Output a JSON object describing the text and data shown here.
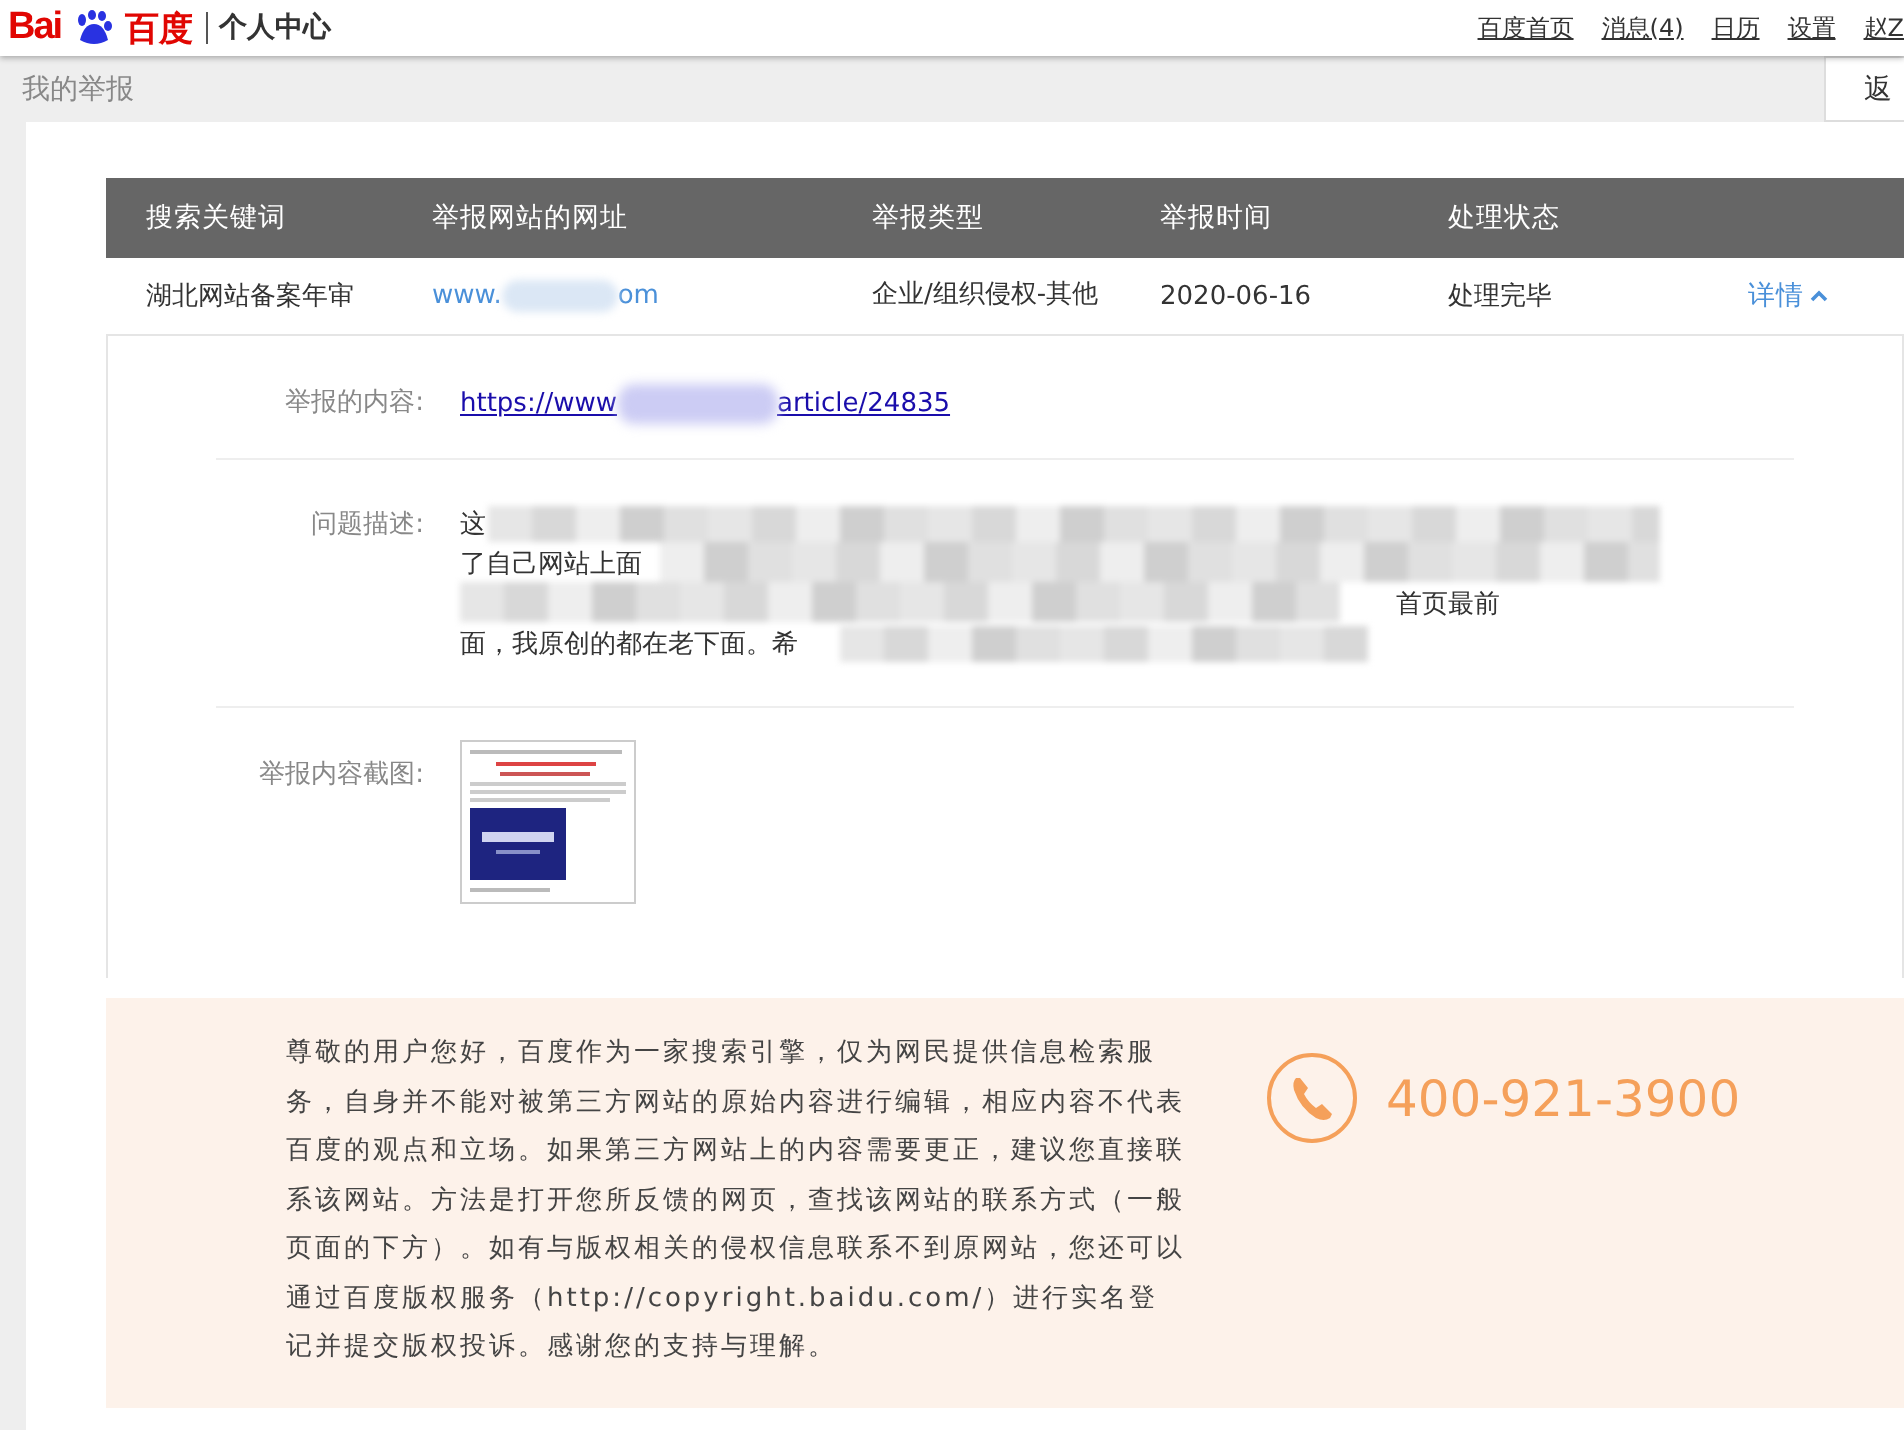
{
  "header": {
    "logo_latin": "Bai",
    "logo_cn": "百度",
    "section": "个人中心",
    "links": [
      "百度首页",
      "消息(4)",
      "日历",
      "设置",
      "赵Z"
    ]
  },
  "subbar": {
    "title": "我的举报",
    "button": "返"
  },
  "table": {
    "columns": [
      "搜索关键词",
      "举报网站的网址",
      "举报类型",
      "举报时间",
      "处理状态"
    ],
    "rows": [
      {
        "keyword": "湖北网站备案年审",
        "url_start": "www.",
        "url_end": "om",
        "type": "企业/组织侵权-其他",
        "time": "2020-06-16",
        "status": "处理完毕",
        "action": "详情",
        "expanded": true
      }
    ]
  },
  "detail": {
    "content_label": "举报的内容:",
    "content_link_start": "https://www",
    "content_link_end": "article/24835",
    "description_label": "问题描述:",
    "description_lines": [
      "这",
      "了自己网站上面",
      "首页最前",
      "面，我原创的都在老下面。希"
    ],
    "screenshot_label": "举报内容截图:"
  },
  "notice": {
    "text": "尊敬的用户您好，百度作为一家搜索引擎，仅为网民提供信息检索服务，自身并不能对被第三方网站的原始内容进行编辑，相应内容不代表百度的观点和立场。如果第三方网站上的内容需要更正，建议您直接联系该网站。方法是打开您所反馈的网页，查找该网站的联系方式（一般页面的下方）。如有与版权相关的侵权信息联系不到原网站，您还可以通过百度版权服务（http://copyright.baidu.com/）进行实名登记并提交版权投诉。感谢您的支持与理解。",
    "phone": "400-921-3900"
  }
}
